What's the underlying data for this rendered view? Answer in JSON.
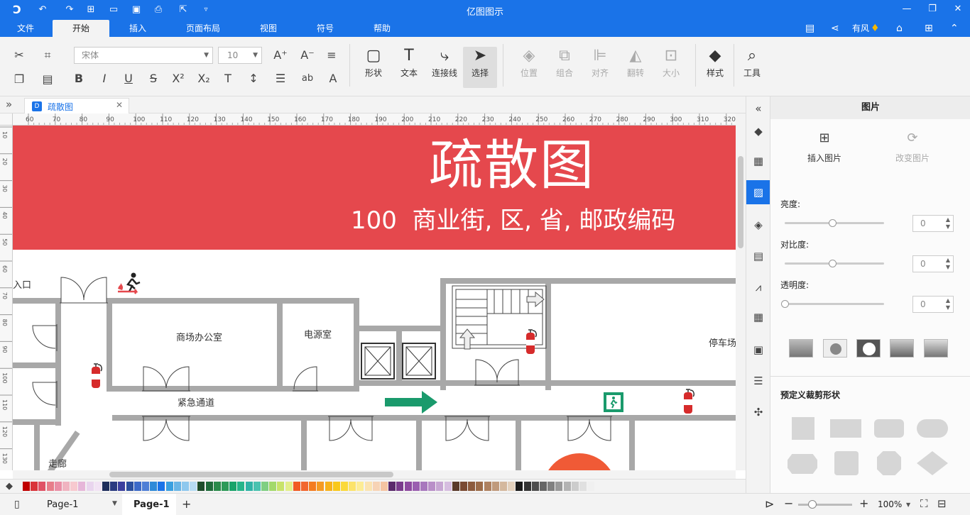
{
  "app": {
    "title": "亿图图示"
  },
  "quick_access": [
    "logo-icon",
    "undo-icon",
    "redo-icon",
    "new-icon",
    "open-icon",
    "save-icon",
    "print-icon",
    "export-icon",
    "customize-icon"
  ],
  "menu": {
    "tabs": [
      "文件",
      "开始",
      "插入",
      "页面布局",
      "视图",
      "符号",
      "帮助"
    ],
    "active": "开始",
    "user": "有风"
  },
  "ribbon": {
    "font_family": "宋体",
    "font_size": "10",
    "shape_label": "形状",
    "text_label": "文本",
    "connector_label": "连接线",
    "select_label": "选择",
    "position_label": "位置",
    "group_label": "组合",
    "align_label": "对齐",
    "flip_label": "翻转",
    "size_label": "大小",
    "style_label": "样式",
    "tools_label": "工具"
  },
  "document": {
    "tab_name": "疏散图"
  },
  "ruler": {
    "top": [
      "60",
      "70",
      "80",
      "90",
      "100",
      "110",
      "120",
      "130",
      "140",
      "150",
      "160",
      "170",
      "180",
      "190",
      "200",
      "210",
      "220",
      "230",
      "240",
      "250",
      "260",
      "270",
      "280",
      "290",
      "300",
      "310",
      "320"
    ],
    "left": [
      "10",
      "20",
      "30",
      "40",
      "50",
      "60",
      "70",
      "80",
      "90",
      "100",
      "110",
      "120",
      "130"
    ]
  },
  "diagram": {
    "title": "疏散图",
    "address": "100  商业街, 区, 省, 邮政编码",
    "banner_color": "#e5484d",
    "rooms": {
      "entrance": "入口",
      "office": "商场办公室",
      "power": "电源室",
      "parking": "停车场",
      "emergency": "紧急通道",
      "corridor": "走廊"
    }
  },
  "panel": {
    "title": "图片",
    "insert_image": "插入图片",
    "change_image": "改变图片",
    "brightness": "亮度:",
    "contrast": "对比度:",
    "transparency": "透明度:",
    "brightness_value": "0",
    "contrast_value": "0",
    "transparency_value": "0",
    "crop_title": "预定义裁剪形状"
  },
  "status": {
    "page_select": "Page-1",
    "page_tab": "Page-1",
    "zoom": "100%"
  },
  "colors": {
    "accent": "#1a73e8",
    "banner": "#e5484d",
    "exit_green": "#1a9a6c",
    "extinguisher": "#d62b2b",
    "circle": "#f05a36"
  }
}
